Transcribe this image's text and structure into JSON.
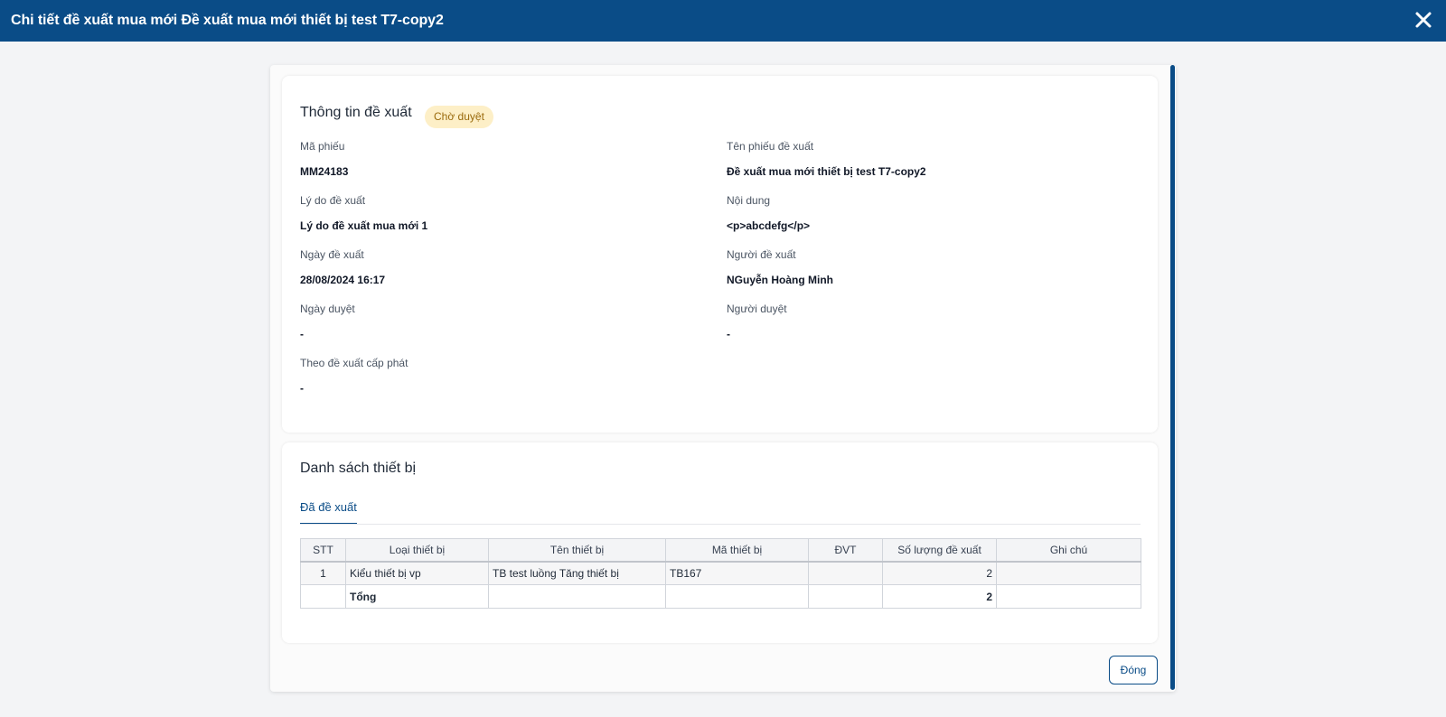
{
  "window": {
    "title": "Chi tiết đề xuất mua mới Đề xuất mua mới thiết bị test T7-copy2",
    "close_icon": "close-icon"
  },
  "info": {
    "title": "Thông tin đề xuất",
    "status": "Chờ duyệt",
    "fields": {
      "ma_phieu": {
        "label": "Mã phiếu",
        "value": "MM24183"
      },
      "ten_phieu": {
        "label": "Tên phiếu đề xuất",
        "value": "Đề xuất mua mới thiết bị test T7-copy2"
      },
      "ly_do": {
        "label": "Lý do đề xuất",
        "value": "Lý do đề xuất mua mới 1"
      },
      "noi_dung": {
        "label": "Nội dung",
        "value": "<p>abcdefg</p>"
      },
      "ngay_de_xuat": {
        "label": "Ngày đề xuất",
        "value": "28/08/2024 16:17"
      },
      "nguoi_de_xuat": {
        "label": "Người đề xuất",
        "value": "NGuyễn Hoàng Minh"
      },
      "ngay_duyet": {
        "label": "Ngày duyệt",
        "value": "-"
      },
      "nguoi_duyet": {
        "label": "Người duyệt",
        "value": "-"
      },
      "theo_de_xuat": {
        "label": "Theo đề xuất cấp phát",
        "value": "-"
      }
    }
  },
  "devices": {
    "title": "Danh sách thiết bị",
    "tab": "Đã đề xuất",
    "columns": [
      "STT",
      "Loại thiết bị",
      "Tên thiết bị",
      "Mã thiết bị",
      "ĐVT",
      "Số lượng đề xuất",
      "Ghi chú"
    ],
    "rows": [
      {
        "stt": "1",
        "loai": "Kiểu thiết bị vp",
        "ten": "TB test luồng Tăng thiết bị",
        "ma": "TB167",
        "dvt": "",
        "so_luong": "2",
        "ghi_chu": ""
      }
    ],
    "total": {
      "label": "Tổng",
      "so_luong": "2"
    }
  },
  "footer": {
    "close_label": "Đóng"
  },
  "colors": {
    "primary": "#0a4c87",
    "badge_bg": "#fdefc7",
    "badge_text": "#9a6a0d"
  }
}
